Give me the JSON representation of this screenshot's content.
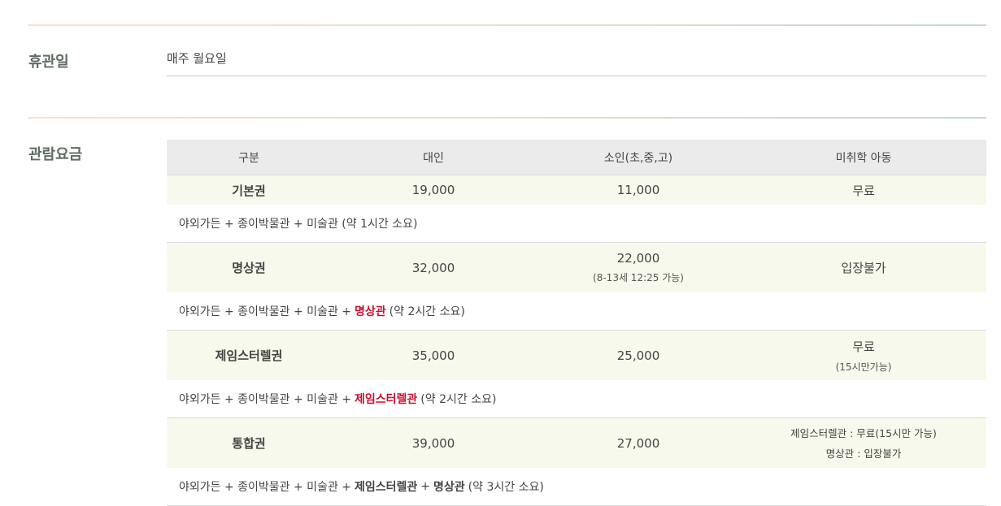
{
  "closed": {
    "label": "휴관일",
    "value": "매주 월요일"
  },
  "fees": {
    "label": "관람요금",
    "headers": [
      "구분",
      "대인",
      "소인(초,중,고)",
      "미취학 아동"
    ],
    "basic": {
      "name": "기본권",
      "adult": "19,000",
      "child": "11,000",
      "preschool": "무료",
      "desc": "야외가든 + 종이박물관 + 미술관 (약 1시간 소요)"
    },
    "meditation": {
      "name": "명상권",
      "adult": "32,000",
      "child": "22,000",
      "child_note": "(8-13세 12:25 가능)",
      "preschool": "입장불가",
      "desc_prefix": "야외가든 + 종이박물관 + 미술관 +",
      "desc_highlight": "명상관",
      "desc_suffix": "(약 2시간 소요)"
    },
    "turrell": {
      "name": "제임스터렐권",
      "adult": "35,000",
      "child": "25,000",
      "preschool": "무료",
      "preschool_note": "(15시만가능)",
      "desc_prefix": "야외가든 + 종이박물관 + 미술관 +",
      "desc_highlight": "제임스터렐관",
      "desc_suffix": "(약 2시간 소요)"
    },
    "combined": {
      "name": "통합권",
      "adult": "39,000",
      "child": "27,000",
      "preschool_line1": "제임스터렐관 : 무료(15시만 가능)",
      "preschool_line2": "명상관 : 입장불가",
      "desc_prefix": "야외가든 + 종이박물관 + 미술관 +",
      "desc_bold1": "제임스터렐관",
      "desc_mid": "+",
      "desc_bold2": "명상관",
      "desc_suffix": "(약 3시간 소요)"
    }
  },
  "colors": {
    "accent_red": "#c8102e",
    "title_green": "#5d6d63",
    "row_tint": "#f7f9ed",
    "header_gray": "#ebebeb"
  }
}
